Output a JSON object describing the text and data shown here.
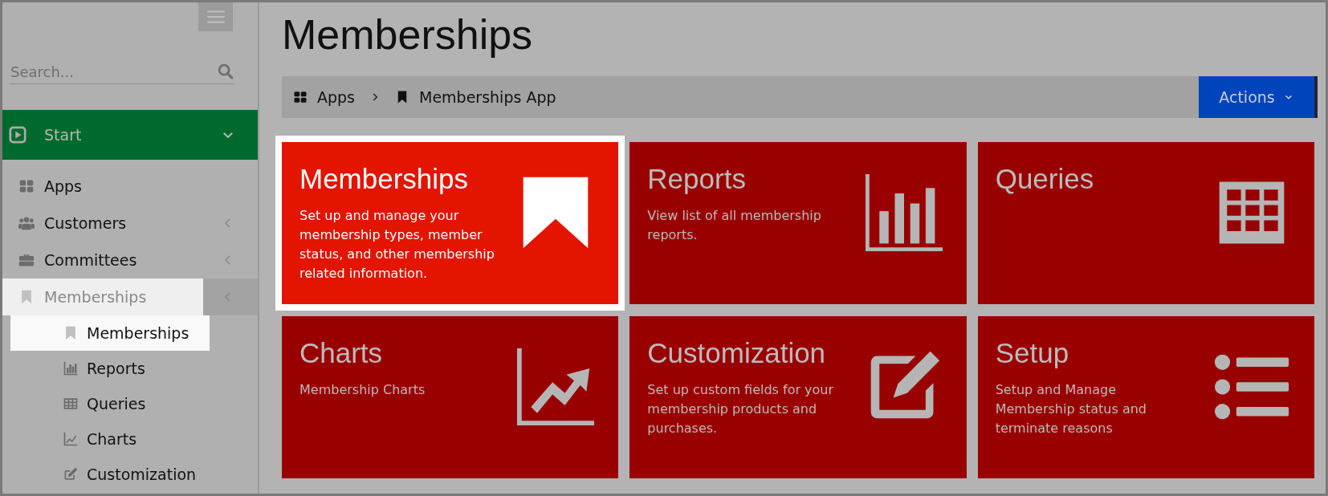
{
  "sidebar": {
    "search": {
      "placeholder": "Search..."
    },
    "start": {
      "label": "Start",
      "expanded": true
    },
    "items": [
      {
        "label": "Apps",
        "highlighted": false
      },
      {
        "label": "Customers",
        "expanded": false,
        "highlighted": false
      },
      {
        "label": "Committees",
        "expanded": false,
        "highlighted": false
      },
      {
        "label": "Memberships",
        "expanded": false,
        "highlighted": true,
        "children": [
          {
            "label": "Memberships",
            "highlighted": true
          },
          {
            "label": "Reports",
            "highlighted": false
          },
          {
            "label": "Queries",
            "highlighted": false
          },
          {
            "label": "Charts",
            "highlighted": false
          },
          {
            "label": "Customization",
            "highlighted": false
          }
        ]
      }
    ]
  },
  "page": {
    "title": "Memberships"
  },
  "breadcrumb": [
    "Apps",
    "Memberships App"
  ],
  "actions_button": "Actions",
  "tiles": [
    {
      "title": "Memberships",
      "description": "Set up and manage your membership types, member status, and other membership related information.",
      "highlighted": true
    },
    {
      "title": "Reports",
      "description": "View list of all membership reports.",
      "highlighted": false
    },
    {
      "title": "Queries",
      "highlighted": false
    },
    {
      "title": "Charts",
      "description": "Membership Charts",
      "highlighted": false
    },
    {
      "title": "Customization",
      "description": "Set up custom fields for your membership products and purchases.",
      "highlighted": false
    },
    {
      "title": "Setup",
      "description": "Setup and Manage Membership status and terminate reasons",
      "highlighted": false
    }
  ]
}
